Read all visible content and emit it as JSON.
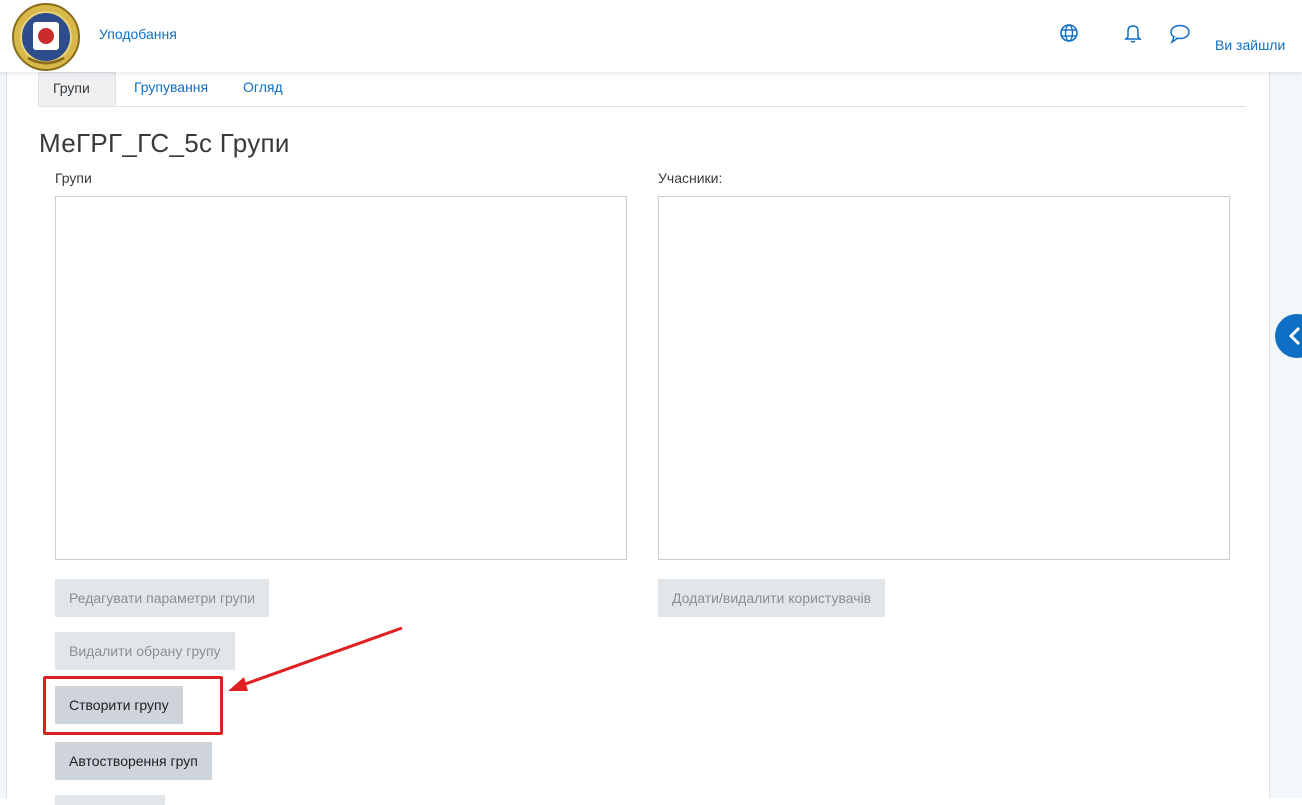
{
  "navbar": {
    "link_label": "Уподобання",
    "user_text": "Ви зайшли",
    "icons": [
      "language-icon",
      "notification-bell-icon",
      "messages-icon"
    ]
  },
  "tabs": [
    {
      "label": "Групи",
      "active": true
    },
    {
      "label": "Групування",
      "active": false
    },
    {
      "label": "Огляд",
      "active": false
    }
  ],
  "page": {
    "title": "МеГРГ_ГС_5с Групи"
  },
  "groups_panel": {
    "label": "Групи",
    "items": []
  },
  "members_panel": {
    "label": "Учасники:",
    "items": []
  },
  "buttons": {
    "edit_group": "Редагувати параметри групи",
    "delete_group": "Видалити обрану групу",
    "create_group": "Створити групу",
    "auto_create": "Автостворення груп",
    "add_remove_users": "Додати/видалити користувачів"
  },
  "colors": {
    "accent": "#0f6fc5",
    "annotation": "#e02020"
  }
}
